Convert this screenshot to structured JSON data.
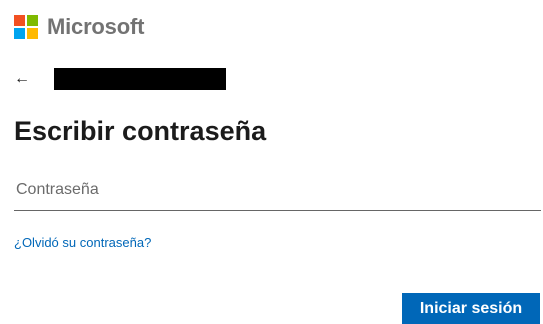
{
  "brand": {
    "name": "Microsoft",
    "logo_icon": "microsoft-logo-icon",
    "logo_colors": [
      "#f25022",
      "#7fba00",
      "#00a4ef",
      "#ffb900"
    ]
  },
  "identity": {
    "back_icon": "←",
    "account": ""
  },
  "title": "Escribir contraseña",
  "password": {
    "placeholder": "Contraseña",
    "value": ""
  },
  "forgot_link": "¿Olvidó su contraseña?",
  "signin_button": "Iniciar sesión",
  "colors": {
    "accent": "#0067b8",
    "brand_text": "#737373"
  }
}
